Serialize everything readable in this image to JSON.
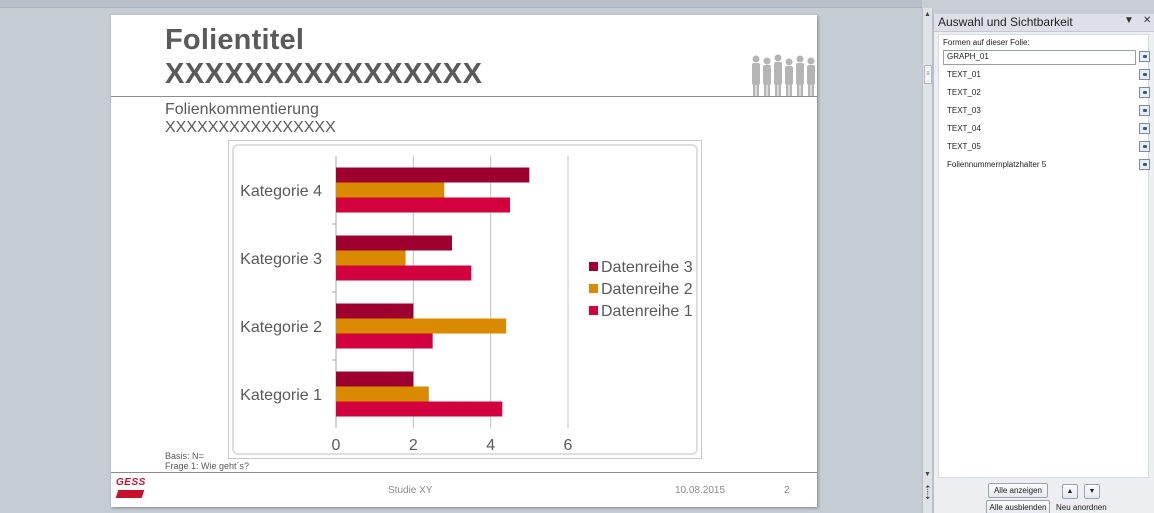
{
  "slide": {
    "title_line1": "Folientitel",
    "title_line2": "XXXXXXXXXXXXXXXX",
    "comment_line1": "Folienkommentierung",
    "comment_line2": "XXXXXXXXXXXXXXXX",
    "basis": "Basis: N=",
    "question": "Frage 1: Wie geht´s?",
    "logo_text": "GESS",
    "footer_study": "Studie XY",
    "footer_date": "10.08.2015",
    "footer_page": "2"
  },
  "chart_data": {
    "type": "bar",
    "orientation": "horizontal",
    "categories": [
      "Kategorie 1",
      "Kategorie 2",
      "Kategorie 3",
      "Kategorie 4"
    ],
    "series": [
      {
        "name": "Datenreihe 1",
        "values": [
          4.3,
          2.5,
          3.5,
          4.5
        ],
        "color": "#d2003c"
      },
      {
        "name": "Datenreihe 2",
        "values": [
          2.4,
          4.4,
          1.8,
          2.8
        ],
        "color": "#d98a00"
      },
      {
        "name": "Datenreihe 3",
        "values": [
          2.0,
          2.0,
          3.0,
          5.0
        ],
        "color": "#9e0030"
      }
    ],
    "xlim": [
      0,
      6
    ],
    "xticks": [
      "0",
      "2",
      "4",
      "6"
    ],
    "grid": true,
    "legend": "right"
  },
  "pane": {
    "title": "Auswahl und Sichtbarkeit",
    "section_label": "Formen auf dieser Folie:",
    "items": [
      {
        "name": "GRAPH_01",
        "selected": true
      },
      {
        "name": "TEXT_01"
      },
      {
        "name": "TEXT_02"
      },
      {
        "name": "TEXT_03"
      },
      {
        "name": "TEXT_04"
      },
      {
        "name": "TEXT_05"
      },
      {
        "name": "Foliennummernplatzhalter 5"
      }
    ],
    "show_all": "Alle anzeigen",
    "hide_all": "Alle ausblenden",
    "reorder": "Neu anordnen"
  }
}
